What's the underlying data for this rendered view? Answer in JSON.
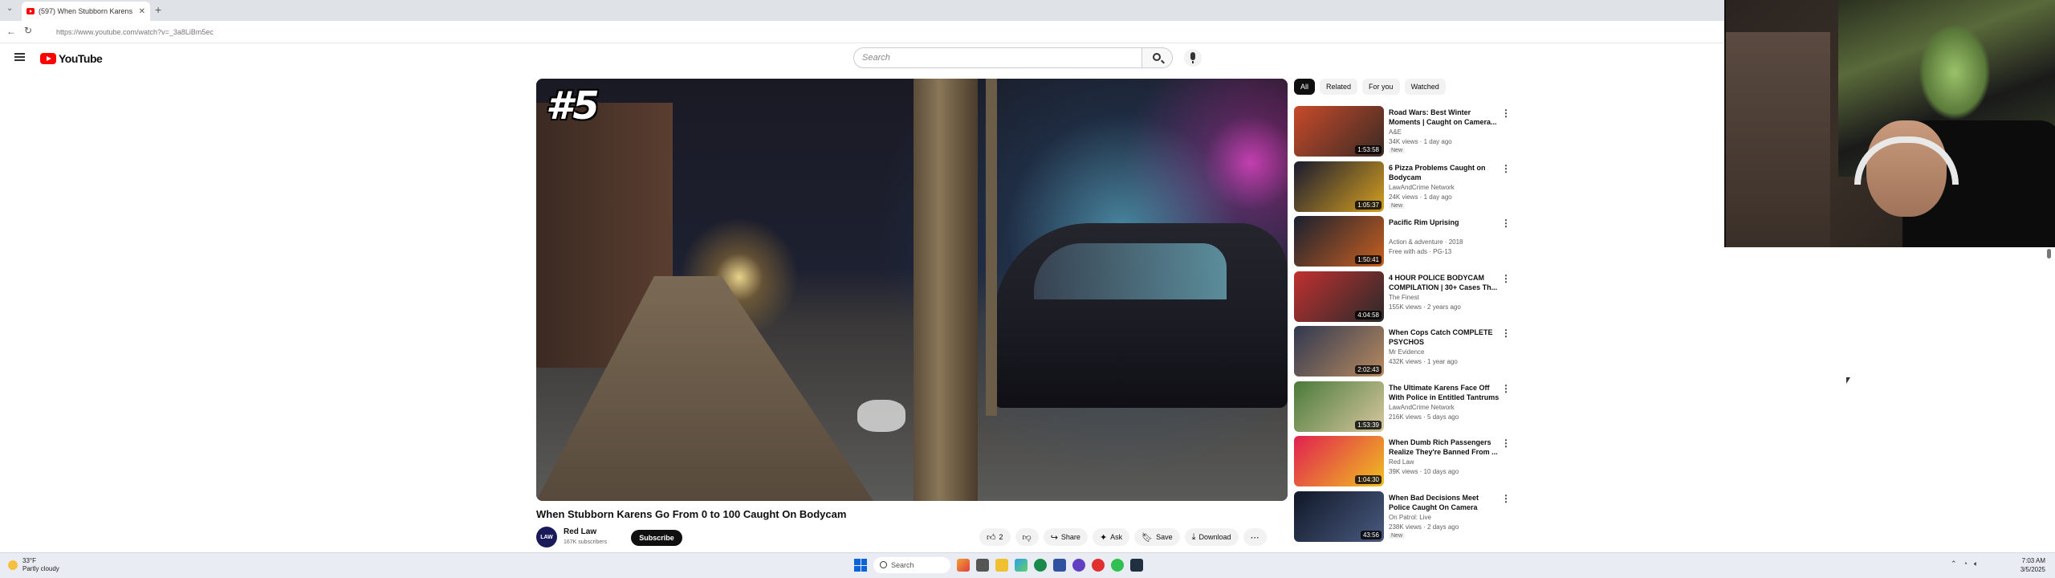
{
  "browser": {
    "tab_title": "(597) When Stubborn Karens",
    "url": "https://www.youtube.com/watch?v=_3a8LiBm5ec"
  },
  "header": {
    "logo_text": "YouTube",
    "search_placeholder": "Search"
  },
  "video": {
    "overlay_badge": "#5",
    "title": "When Stubborn Karens Go From 0 to 100 Caught On Bodycam",
    "channel_name": "Red Law",
    "channel_avatar_text": "LAW",
    "channel_subs": "167K subscribers",
    "subscribe_label": "Subscribe",
    "like_count": "2",
    "share_label": "Share",
    "ask_label": "Ask",
    "save_label": "Save",
    "download_label": "Download"
  },
  "chips": [
    "All",
    "Related",
    "For you",
    "Watched"
  ],
  "recommendations": [
    {
      "title": "Road Wars: Best Winter Moments | Caught on Camera...",
      "channel": "A&E",
      "meta": "34K views · 1 day ago",
      "badge": "New",
      "duration": "1:53:58",
      "colors": [
        "#c84a2a",
        "#3a2a24"
      ]
    },
    {
      "title": "6 Pizza Problems Caught on Bodycam",
      "channel": "LawAndCrime Network",
      "meta": "24K views · 1 day ago",
      "badge": "New",
      "duration": "1:05:37",
      "colors": [
        "#1a1a30",
        "#d4a020"
      ]
    },
    {
      "title": "Pacific Rim Uprising",
      "channel": "Action & adventure · 2018",
      "meta": "Free with ads · PG-13",
      "badge": "",
      "duration": "1:50:41",
      "colors": [
        "#1a2030",
        "#c86020"
      ]
    },
    {
      "title": "4 HOUR POLICE BODYCAM COMPILATION | 30+ Cases Th...",
      "channel": "The Finest",
      "meta": "155K views · 2 years ago",
      "badge": "",
      "duration": "4:04:58",
      "colors": [
        "#c03030",
        "#2a2a2a"
      ]
    },
    {
      "title": "When Cops Catch COMPLETE PSYCHOS",
      "channel": "Mr Evidence",
      "meta": "432K views · 1 year ago",
      "badge": "",
      "duration": "2:02:43",
      "colors": [
        "#303850",
        "#b88a60"
      ]
    },
    {
      "title": "The Ultimate Karens Face Off With Police in Entitled Tantrums",
      "channel": "LawAndCrime Network",
      "meta": "216K views · 5 days ago",
      "badge": "",
      "duration": "1:53:39",
      "colors": [
        "#4a7a3a",
        "#d8c8a0"
      ]
    },
    {
      "title": "When Dumb Rich Passengers Realize They're Banned From ...",
      "channel": "Red Law",
      "meta": "39K views · 10 days ago",
      "badge": "",
      "duration": "1:04:30",
      "colors": [
        "#e02050",
        "#f0c020"
      ]
    },
    {
      "title": "When Bad Decisions Meet Police Caught On Camera",
      "channel": "On Patrol: Live",
      "meta": "238K views · 2 days ago",
      "badge": "New",
      "duration": "43:56",
      "colors": [
        "#101828",
        "#4a5a80"
      ]
    }
  ],
  "taskbar": {
    "weather_temp": "33°F",
    "weather_desc": "Partly cloudy",
    "search_label": "Search",
    "time": "7:03 AM",
    "date": "3/5/2025"
  },
  "colors": {
    "brand_red": "#ff0000"
  }
}
